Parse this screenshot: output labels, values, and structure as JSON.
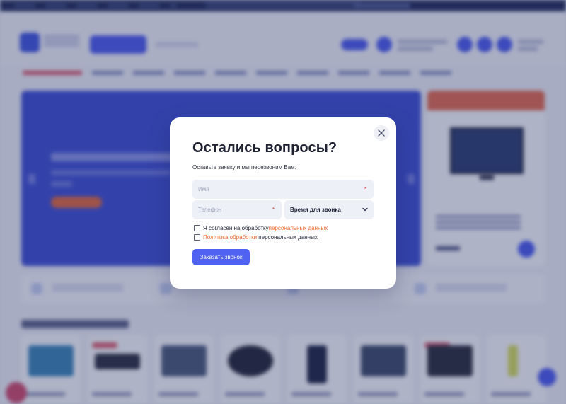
{
  "modal": {
    "title": "Остались вопросы?",
    "subtitle": "Оставьте заявку и мы перезвоним Вам.",
    "fields": {
      "name_placeholder": "Имя",
      "phone_placeholder": "Телефон",
      "call_time_value": "Время для звонка",
      "required_mark": "*"
    },
    "consent": {
      "checkbox1_text": "Я согласен на обработку ",
      "checkbox1_link": "персональных данных",
      "checkbox2_link": "Политика обработки",
      "checkbox2_text": " персональных данных"
    },
    "submit_label": "Заказать звонок"
  },
  "colors": {
    "accent": "#5062f2",
    "link": "#ec6a2f",
    "required": "#e0322f",
    "overlay": "rgba(32,44,98,0.36)"
  },
  "icons": {
    "close": "close-icon",
    "chevron": "chevron-down-icon"
  }
}
